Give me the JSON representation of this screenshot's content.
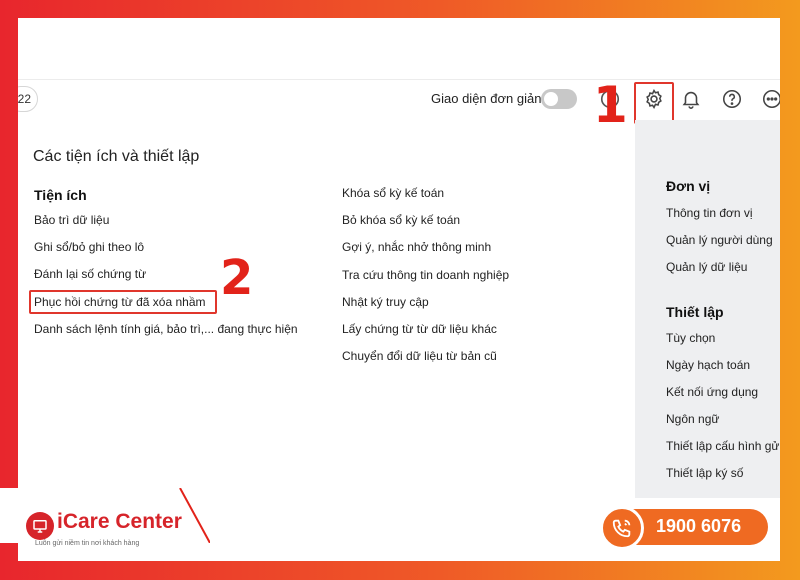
{
  "header": {
    "page_chip": "22",
    "simple_mode_label": "Giao diện đơn giản"
  },
  "callouts": {
    "step1": "1",
    "step2": "2"
  },
  "panel": {
    "title": "Các tiện ích và thiết lập",
    "utilities": {
      "heading": "Tiện ích",
      "col1": [
        "Bảo trì dữ liệu",
        "Ghi sổ/bỏ ghi theo lô",
        "Đánh lại số chứng từ",
        "Phục hồi chứng từ đã xóa nhầm",
        "Danh sách lệnh tính giá, bảo trì,... đang thực hiện"
      ],
      "col2": [
        "Khóa sổ kỳ kế toán",
        "Bỏ khóa sổ kỳ kế toán",
        "Gợi ý, nhắc nhở thông minh",
        "Tra cứu thông tin doanh nghiệp",
        "Nhật ký truy cập",
        "Lấy chứng từ từ dữ liệu khác",
        "Chuyển đổi dữ liệu từ bản cũ"
      ]
    },
    "unit": {
      "heading": "Đơn vị",
      "items": [
        "Thông tin đơn vị",
        "Quản lý người dùng",
        "Quản lý dữ liệu"
      ]
    },
    "settings": {
      "heading": "Thiết lập",
      "items": [
        "Tùy chọn",
        "Ngày hạch toán",
        "Kết nối ứng dụng",
        "Ngôn ngữ",
        "Thiết lập cấu hình gửi",
        "Thiết lập ký số"
      ]
    }
  },
  "footer": {
    "brand": "iCare Center",
    "tagline": "Luôn gửi niềm tin nơi khách hàng",
    "hotline": "1900 6076"
  },
  "colors": {
    "accent_red": "#e2231a",
    "hotline_orange": "#ef6a22"
  }
}
